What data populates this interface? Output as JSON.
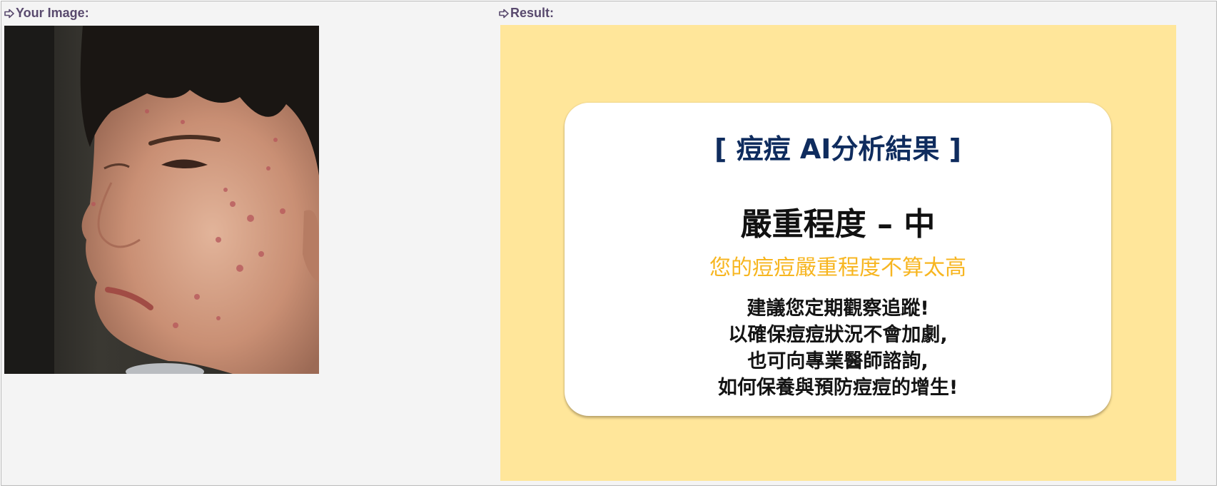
{
  "left_panel": {
    "heading": "Your Image:"
  },
  "right_panel": {
    "heading": "Result:"
  },
  "result_card": {
    "title": "[ 痘痘 AI分析結果 ]",
    "severity": "嚴重程度 – 中",
    "summary": "您的痘痘嚴重程度不算太高",
    "advice_lines": [
      "建議您定期觀察追蹤!",
      "以確保痘痘狀況不會加劇,",
      "也可向專業醫師諮詢,",
      "如何保養與預防痘痘的增生!"
    ]
  },
  "colors": {
    "result_background": "#ffe69a",
    "title": "#0f2c5e",
    "summary": "#f7b621",
    "heading": "#594a6e"
  }
}
